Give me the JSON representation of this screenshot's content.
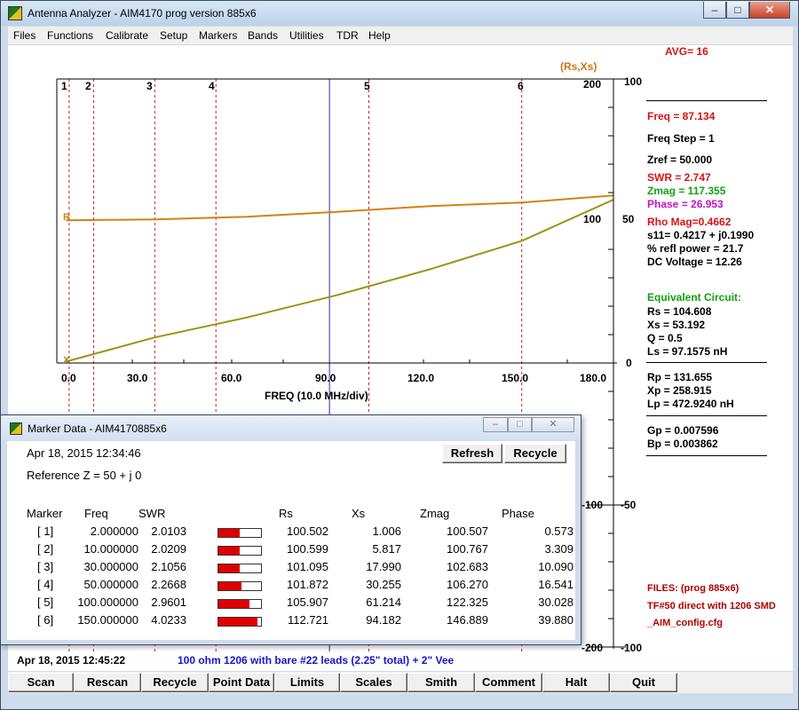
{
  "window": {
    "title": "Antenna Analyzer - AIM4170    prog version 885x6",
    "minimize": "–",
    "maximize": "□",
    "close": "✕"
  },
  "menu": [
    "Files",
    "Functions",
    "Calibrate",
    "Setup",
    "Markers",
    "Bands",
    "Utilities",
    "TDR",
    "Help"
  ],
  "header": {
    "avg": "AVG=  16",
    "rsxs_label": "(Rs,Xs)"
  },
  "colors": {
    "r_curve": "#d4820e",
    "x_curve": "#9a9414",
    "marker_line": "#d01818",
    "cursor_line": "#2a2aa0",
    "swr": "#e00000",
    "zmag": "#14a014",
    "phase": "#c414c4",
    "equiv": "#14a014",
    "files": "#b00000",
    "note": "#1414c8"
  },
  "plot": {
    "markers": [
      "1",
      "2",
      "3",
      "4",
      "5",
      "6"
    ],
    "left_axis_ticks": [
      "200",
      "100",
      "0",
      "-100",
      "-200"
    ],
    "right_axis_top": [
      "100",
      "50",
      "0",
      "-50",
      "-100"
    ],
    "right_axis_inner": [
      "100",
      "50",
      "0",
      "-50",
      "-100"
    ],
    "x_ticks": [
      "0.0",
      "30.0",
      "60.0",
      "90.0",
      "120.0",
      "150.0",
      "180.0"
    ],
    "x_label": "FREQ (10.0 MHz/div)",
    "curve_labels": {
      "r": "R",
      "x": "X"
    }
  },
  "chart_data": {
    "type": "line",
    "xlabel": "FREQ (10.0 MHz/div)",
    "ylabel": "(Rs,Xs)",
    "xlim": [
      0,
      180
    ],
    "ylim": [
      -200,
      200
    ],
    "grid": false,
    "series": [
      {
        "name": "R",
        "x": [
          1,
          30,
          60,
          90,
          120,
          150,
          180
        ],
        "values": [
          100.5,
          101.1,
          103.0,
          106.5,
          110.5,
          113.0,
          118.0
        ]
      },
      {
        "name": "X",
        "x": [
          1,
          30,
          60,
          90,
          120,
          150,
          180
        ],
        "values": [
          1.0,
          18.0,
          32.0,
          48.0,
          66.0,
          86.0,
          115.0
        ]
      }
    ],
    "markers_x": [
      2,
      10,
      30,
      50,
      100,
      150
    ],
    "cursor_x": 87.134
  },
  "readout": {
    "freq": "Freq = 87.134",
    "freq_step": "Freq Step = 1",
    "zref": "Zref =  50.000",
    "swr": "SWR  =   2.747",
    "zmag": "Zmag = 117.355",
    "phase": "Phase =   26.953",
    "rho": "Rho Mag=0.4662",
    "s11": "s11= 0.4217 + j0.1990",
    "refl": "% refl power = 21.7",
    "dcv": "DC Voltage =  12.26",
    "equiv_title": "Equivalent Circuit:",
    "rs": "Rs =  104.608",
    "xs": "Xs =   53.192",
    "q": "Q =  0.5",
    "ls": "Ls =   97.1575  nH",
    "rp": "Rp =  131.655",
    "xp": "Xp =  258.915",
    "lp": "Lp =  472.9240  nH",
    "gp": "Gp =  0.007596",
    "bp": "Bp =  0.003862",
    "files1": "FILES:  (prog 885x6)",
    "files2": "TF#50 direct with 1206 SMD",
    "files3": "_AIM_config.cfg"
  },
  "status": {
    "datetime": "Apr 18, 2015  12:45:22",
    "note": "100 ohm 1206 with bare #22 leads (2.25\" total) + 2\" Vee"
  },
  "buttons": [
    "Scan",
    "Rescan",
    "Recycle",
    "Point Data",
    "Limits",
    "Scales",
    "Smith",
    "Comment",
    "Halt",
    "Quit"
  ],
  "dialog": {
    "title": "Marker Data -  AIM4170885x6",
    "date": "Apr 18, 2015  12:34:46",
    "refresh": "Refresh",
    "recycle": "Recycle",
    "refz": "Reference Z = 50  + j 0",
    "headers": {
      "marker": "Marker",
      "freq": "Freq",
      "swr": "SWR",
      "rs": "Rs",
      "xs": "Xs",
      "zmag": "Zmag",
      "phase": "Phase"
    },
    "rows": [
      {
        "m": "[  1]",
        "freq": "2.000000",
        "swr": "2.0103",
        "bar": 0.5,
        "rs": "100.502",
        "xs": "1.006",
        "zmag": "100.507",
        "phase": "0.573"
      },
      {
        "m": "[  2]",
        "freq": "10.000000",
        "swr": "2.0209",
        "bar": 0.5,
        "rs": "100.599",
        "xs": "5.817",
        "zmag": "100.767",
        "phase": "3.309"
      },
      {
        "m": "[  3]",
        "freq": "30.000000",
        "swr": "2.1056",
        "bar": 0.5,
        "rs": "101.095",
        "xs": "17.990",
        "zmag": "102.683",
        "phase": "10.090"
      },
      {
        "m": "[  4]",
        "freq": "50.000000",
        "swr": "2.2668",
        "bar": 0.55,
        "rs": "101.872",
        "xs": "30.255",
        "zmag": "106.270",
        "phase": "16.541"
      },
      {
        "m": "[  5]",
        "freq": "100.000000",
        "swr": "2.9601",
        "bar": 0.72,
        "rs": "105.907",
        "xs": "61.214",
        "zmag": "122.325",
        "phase": "30.028"
      },
      {
        "m": "[  6]",
        "freq": "150.000000",
        "swr": "4.0233",
        "bar": 0.92,
        "rs": "112.721",
        "xs": "94.182",
        "zmag": "146.889",
        "phase": "39.880"
      }
    ]
  }
}
